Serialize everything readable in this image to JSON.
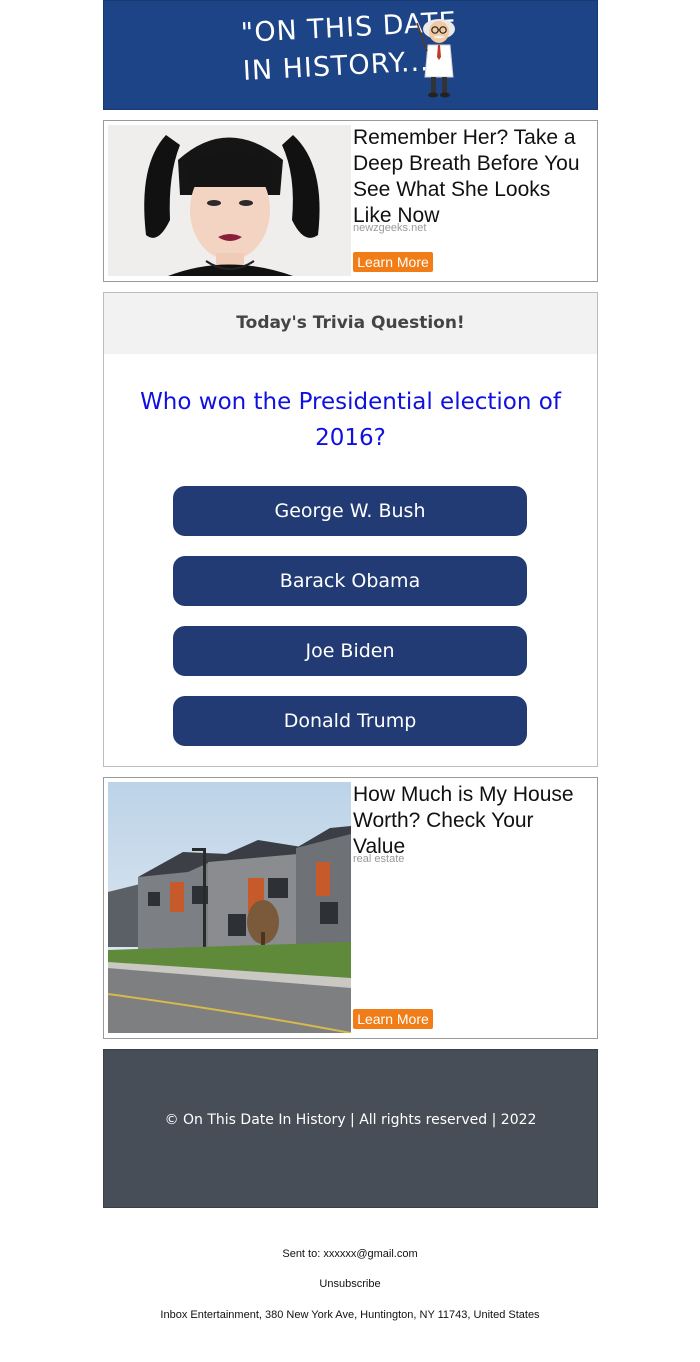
{
  "header": {
    "logo_line1": "\"ON THIS DATE",
    "logo_line2": "IN HISTORY...\"",
    "brand_color": "#1d4487"
  },
  "ad_top": {
    "title": "Remember Her? Take a Deep Breath Before You See What She Looks Like Now",
    "source": "newzgeeks.net",
    "button": "Learn More"
  },
  "trivia": {
    "heading": "Today's Trivia Question!",
    "question": "Who won the Presidential election of 2016?",
    "answers": [
      "George W. Bush",
      "Barack Obama",
      "Joe Biden",
      "Donald Trump"
    ],
    "answer_color": "#223b74",
    "question_color": "#1010e0"
  },
  "ad_bottom": {
    "title": "How Much is My House Worth? Check Your Value",
    "source": "real estate",
    "button": "Learn More",
    "button_color": "#f07d17"
  },
  "footer": {
    "copyright": "© On This Date In History | All rights reserved | 2022"
  },
  "meta": {
    "sent_to": "Sent to: xxxxxx@gmail.com",
    "unsubscribe": "Unsubscribe",
    "address": "Inbox Entertainment, 380 New York Ave, Huntington, NY 11743, United States"
  }
}
